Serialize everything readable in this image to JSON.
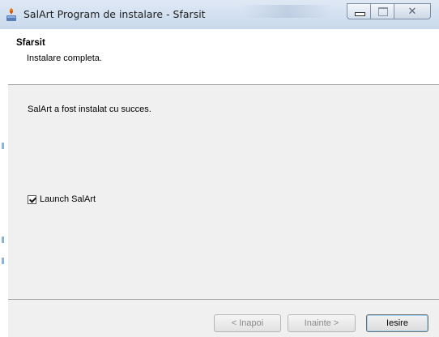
{
  "window": {
    "title": "SalArt Program de instalare - Sfarsit",
    "controls": {
      "minimize_icon": "minimize-icon",
      "maximize_icon": "maximize-icon",
      "close_icon": "close-icon",
      "close_glyph": "✕"
    }
  },
  "header": {
    "title": "Sfarsit",
    "subtitle": "Instalare completa."
  },
  "content": {
    "message": "SalArt a fost instalat cu succes.",
    "launch_checkbox": {
      "label": "Launch SalArt",
      "checked": true
    }
  },
  "footer": {
    "back_label": "< Inapoi",
    "next_label": "Inainte >",
    "exit_label": "Iesire"
  },
  "colors": {
    "accent": "#9fd1f0",
    "titlebar": "#dfe9f5",
    "panel": "#f0f0f0"
  }
}
